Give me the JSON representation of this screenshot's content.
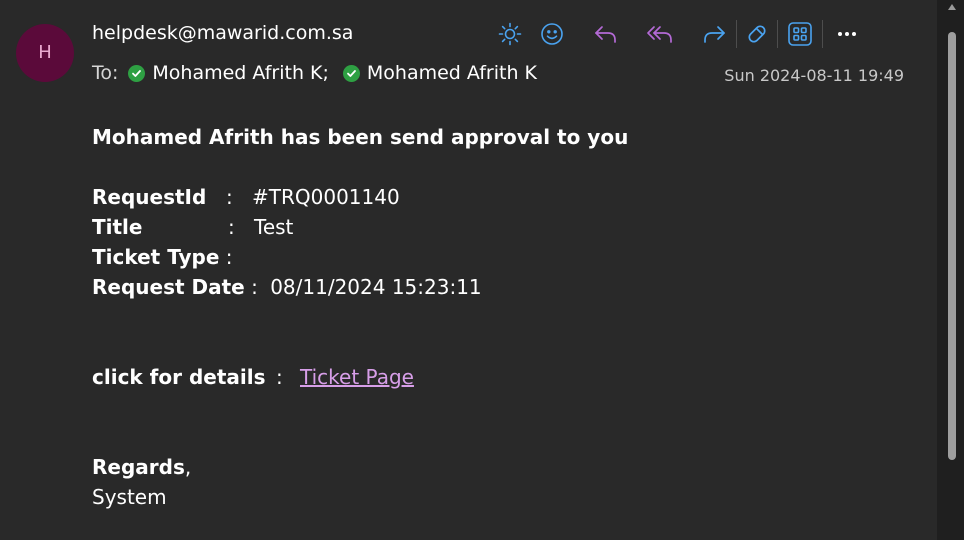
{
  "header": {
    "avatar_initial": "H",
    "sender": "helpdesk@mawarid.com.sa",
    "to_label": "To:",
    "recipients": [
      "Mohamed Afrith K;",
      "Mohamed Afrith K"
    ],
    "date": "Sun 2024-08-11 19:49"
  },
  "toolbar": {
    "icons": [
      "sun-icon",
      "emoji-icon",
      "reply-icon",
      "reply-all-icon",
      "forward-icon",
      "immersive-reader-icon",
      "apps-icon",
      "more-icon"
    ],
    "colors": {
      "blue": "#4aa3f0",
      "purple": "#b46ad6",
      "more": "#ffffff"
    }
  },
  "body": {
    "heading": "Mohamed Afrith has been send approval to you",
    "fields": [
      {
        "label": "RequestId",
        "colon": ":",
        "value": "#TRQ0001140"
      },
      {
        "label": "Title",
        "colon": ":",
        "value": "Test"
      },
      {
        "label": "Ticket Type",
        "colon": ":",
        "value": ""
      },
      {
        "label": "Request Date",
        "colon": ":",
        "value": "08/11/2024 15:23:11"
      }
    ],
    "details_label": "click for details",
    "details_colon": ":",
    "details_link": "Ticket Page",
    "regards": "Regards",
    "regards_comma": ",",
    "signature": "System"
  }
}
